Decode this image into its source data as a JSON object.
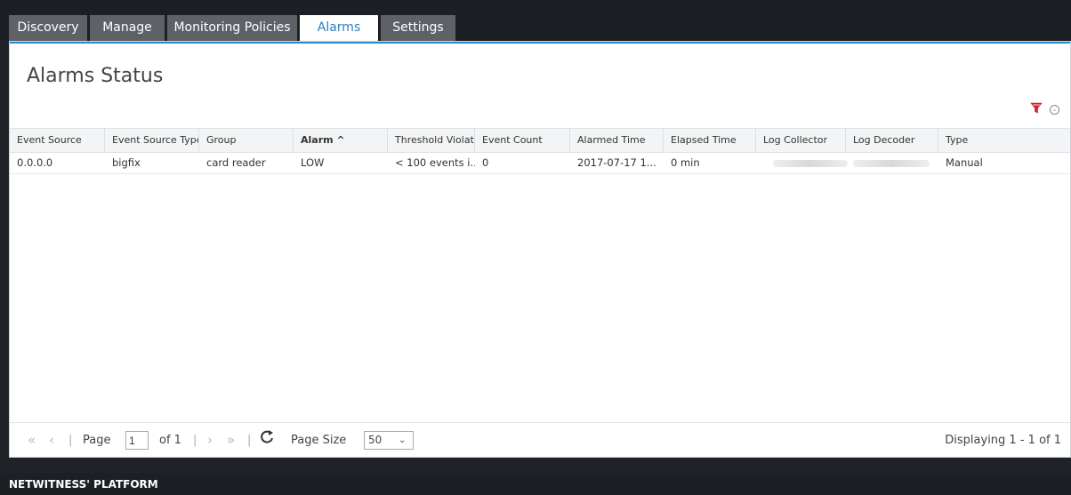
{
  "tabs": [
    {
      "label": "Discovery"
    },
    {
      "label": "Manage"
    },
    {
      "label": "Monitoring Policies"
    },
    {
      "label": "Alarms",
      "active": true
    },
    {
      "label": "Settings"
    }
  ],
  "panel": {
    "title": "Alarms Status"
  },
  "icons": {
    "filter": "filter-icon",
    "options": "chevron-down-circle-icon"
  },
  "table": {
    "columns": [
      "Event Source",
      "Event Source Type",
      "Group",
      "Alarm ^",
      "Threshold Violated",
      "Event Count",
      "Alarmed Time",
      "Elapsed Time",
      "Log Collector",
      "Log Decoder",
      "Type"
    ],
    "rows": [
      [
        "0.0.0.0",
        "bigfix",
        "card reader",
        "LOW",
        "< 100 events i...",
        "0",
        "2017-07-17 1...",
        "0 min",
        "",
        "",
        "Manual"
      ]
    ]
  },
  "pager": {
    "page_label": "Page",
    "page_value": "1",
    "of_label": "of 1",
    "page_size_label": "Page Size",
    "page_size_value": "50",
    "displaying": "Displaying 1 - 1 of 1"
  },
  "footer": {
    "brand": "NETWITNESS' PLATFORM"
  },
  "colors": {
    "accent": "#2d8bc8",
    "tab_bg": "#5e6268",
    "active_tab_text": "#2f7fb9",
    "filter_red": "#d9232d"
  }
}
